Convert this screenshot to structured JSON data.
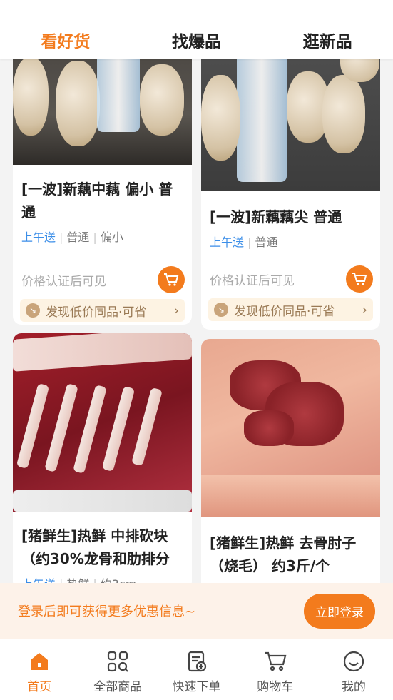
{
  "tabs": [
    {
      "label": "看好货",
      "active": true
    },
    {
      "label": "找爆品",
      "active": false
    },
    {
      "label": "逛新品",
      "active": false
    }
  ],
  "products": [
    {
      "title": "[一波]新藕中藕 偏小 普通",
      "tags": [
        "上午送",
        "普通",
        "偏小"
      ],
      "price_text": "价格认证后可见",
      "promo_text": "发现低价同品·可省"
    },
    {
      "title": "[一波]新藕藕尖 普通",
      "tags": [
        "上午送",
        "普通"
      ],
      "price_text": "价格认证后可见",
      "promo_text": "发现低价同品·可省"
    },
    {
      "title": "[猪鲜生]热鲜 中排砍块（约30%龙骨和肋排分",
      "tags": [
        "上午送",
        "热鲜",
        "约3cm"
      ]
    },
    {
      "title": "[猪鲜生]热鲜 去骨肘子（烧毛） 约3斤/个",
      "tags": []
    }
  ],
  "login_bar": {
    "text": "登录后即可获得更多优惠信息~",
    "button": "立即登录"
  },
  "bottom_nav": [
    {
      "label": "首页",
      "icon": "home-icon",
      "active": true
    },
    {
      "label": "全部商品",
      "icon": "grid-search-icon",
      "active": false
    },
    {
      "label": "快速下单",
      "icon": "quick-order-icon",
      "active": false
    },
    {
      "label": "购物车",
      "icon": "cart-icon",
      "active": false
    },
    {
      "label": "我的",
      "icon": "smile-icon",
      "active": false
    }
  ],
  "colors": {
    "accent": "#f37b1d",
    "tag_blue": "#3b8ee8",
    "promo_bg": "#fdf3e3"
  }
}
